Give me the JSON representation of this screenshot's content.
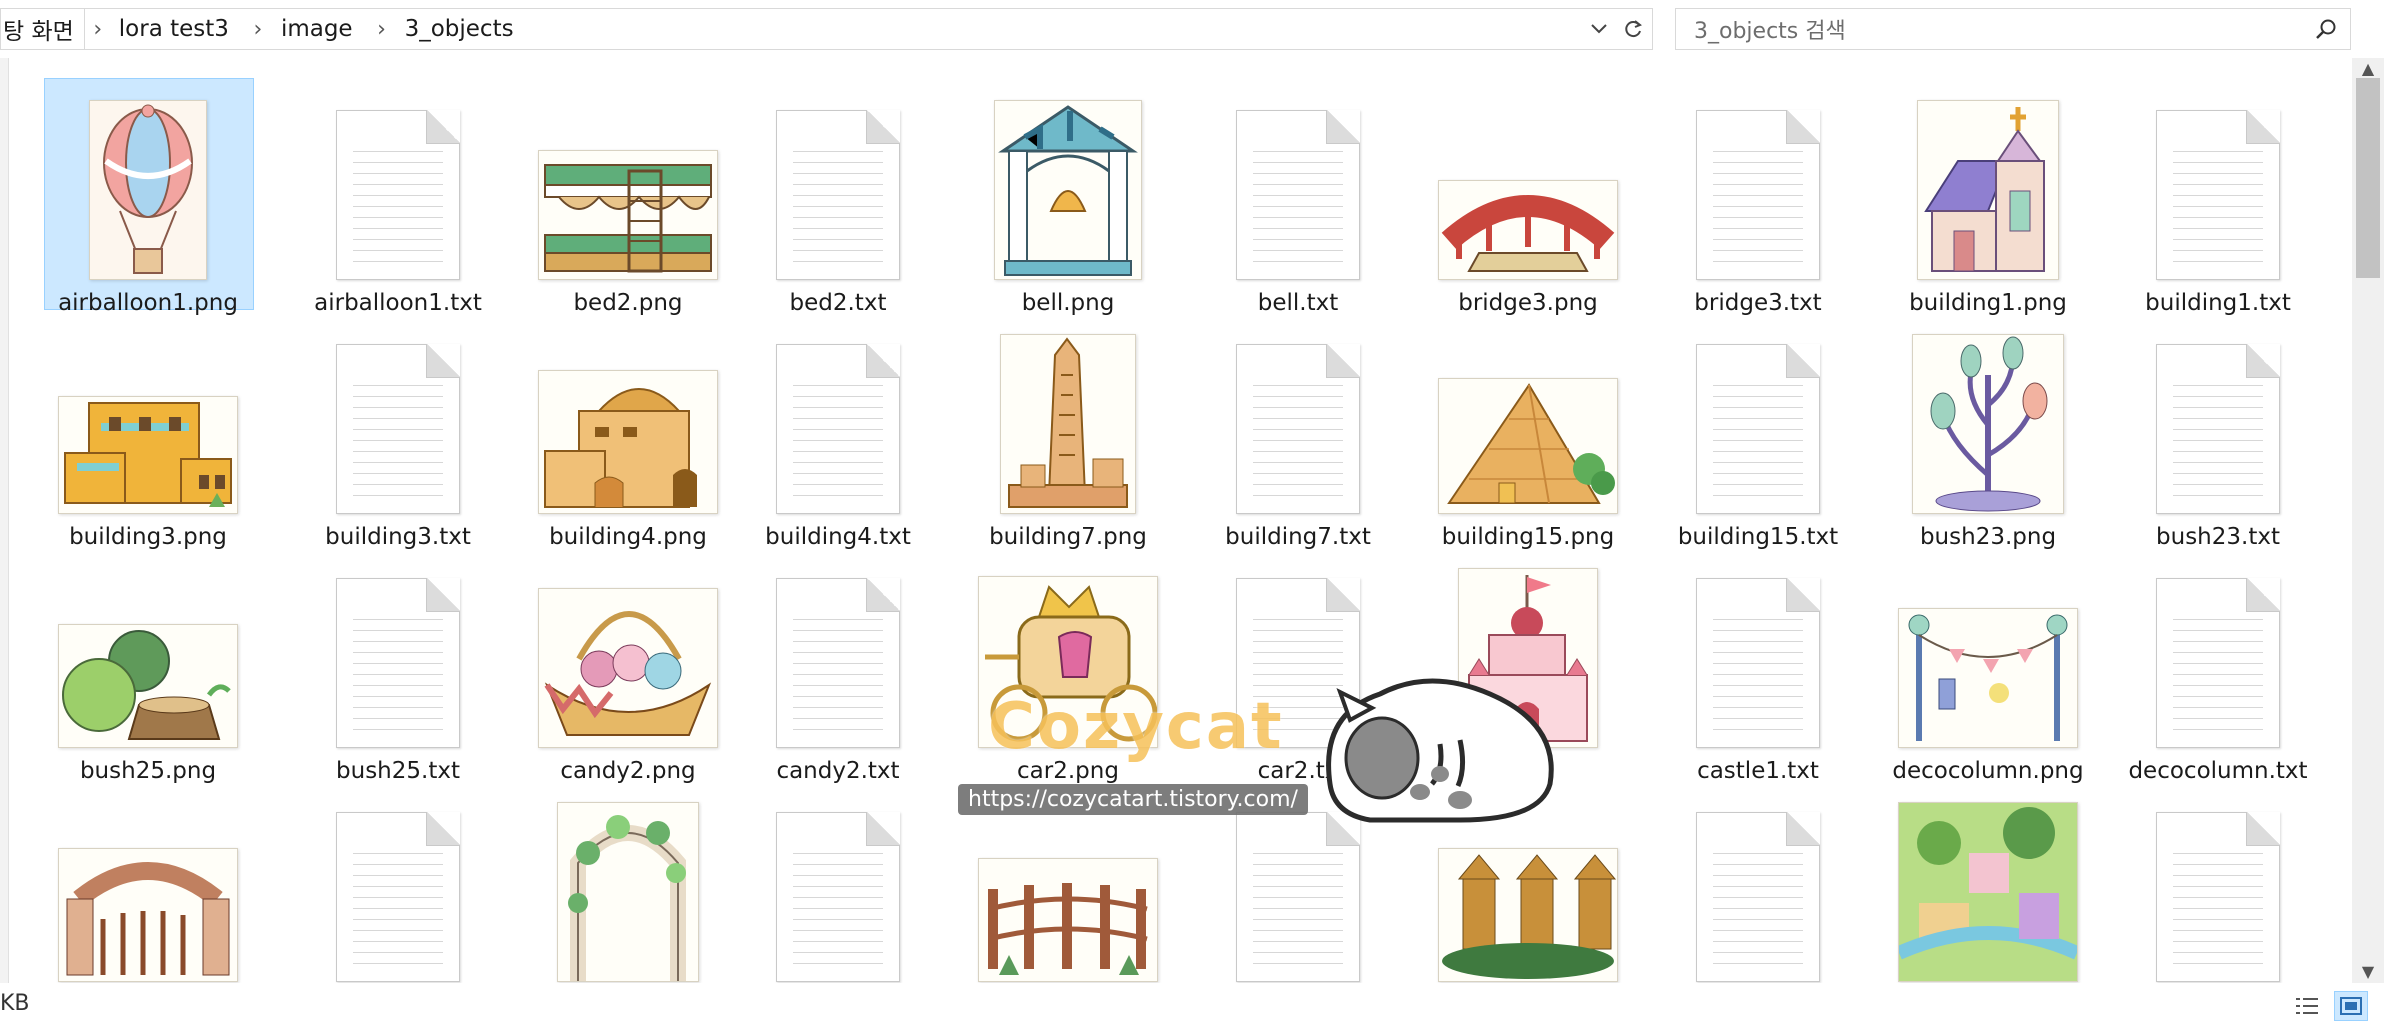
{
  "address_bar": {
    "crumbs": [
      "탕 화면",
      "lora test3",
      "image",
      "3_objects"
    ]
  },
  "search": {
    "placeholder": "3_objects 검색"
  },
  "files": [
    {
      "name": "airballoon1.png",
      "kind": "image",
      "selected": true
    },
    {
      "name": "airballoon1.txt",
      "kind": "text"
    },
    {
      "name": "bed2.png",
      "kind": "image"
    },
    {
      "name": "bed2.txt",
      "kind": "text"
    },
    {
      "name": "bell.png",
      "kind": "image"
    },
    {
      "name": "bell.txt",
      "kind": "text"
    },
    {
      "name": "bridge3.png",
      "kind": "image"
    },
    {
      "name": "bridge3.txt",
      "kind": "text"
    },
    {
      "name": "building1.png",
      "kind": "image"
    },
    {
      "name": "building1.txt",
      "kind": "text"
    },
    {
      "name": "building3.png",
      "kind": "image"
    },
    {
      "name": "building3.txt",
      "kind": "text"
    },
    {
      "name": "building4.png",
      "kind": "image"
    },
    {
      "name": "building4.txt",
      "kind": "text"
    },
    {
      "name": "building7.png",
      "kind": "image"
    },
    {
      "name": "building7.txt",
      "kind": "text"
    },
    {
      "name": "building15.png",
      "kind": "image"
    },
    {
      "name": "building15.txt",
      "kind": "text"
    },
    {
      "name": "bush23.png",
      "kind": "image"
    },
    {
      "name": "bush23.txt",
      "kind": "text"
    },
    {
      "name": "bush25.png",
      "kind": "image"
    },
    {
      "name": "bush25.txt",
      "kind": "text"
    },
    {
      "name": "candy2.png",
      "kind": "image"
    },
    {
      "name": "candy2.txt",
      "kind": "text"
    },
    {
      "name": "car2.png",
      "kind": "image"
    },
    {
      "name": "car2.txt",
      "kind": "text"
    },
    {
      "name": "castle1.png",
      "kind": "image"
    },
    {
      "name": "castle1.txt",
      "kind": "text"
    },
    {
      "name": "decocolumn.png",
      "kind": "image"
    },
    {
      "name": "decocolumn.txt",
      "kind": "text"
    },
    {
      "name": "",
      "kind": "image"
    },
    {
      "name": "",
      "kind": "text"
    },
    {
      "name": "",
      "kind": "image"
    },
    {
      "name": "",
      "kind": "text"
    },
    {
      "name": "",
      "kind": "image"
    },
    {
      "name": "",
      "kind": "text"
    },
    {
      "name": "",
      "kind": "image"
    },
    {
      "name": "",
      "kind": "text"
    },
    {
      "name": "",
      "kind": "image"
    },
    {
      "name": "",
      "kind": "text"
    }
  ],
  "castle_label_visible": "png",
  "car_txt_label_visible": "car2.tx",
  "status": {
    "size_text": "KB"
  },
  "watermark": {
    "brand": "Cozycat",
    "url": "https://cozycatart.tistory.com/"
  },
  "colors": {
    "selection": "#cce8ff",
    "selection_border": "#99d1ff",
    "watermark": "#f6c15a"
  }
}
